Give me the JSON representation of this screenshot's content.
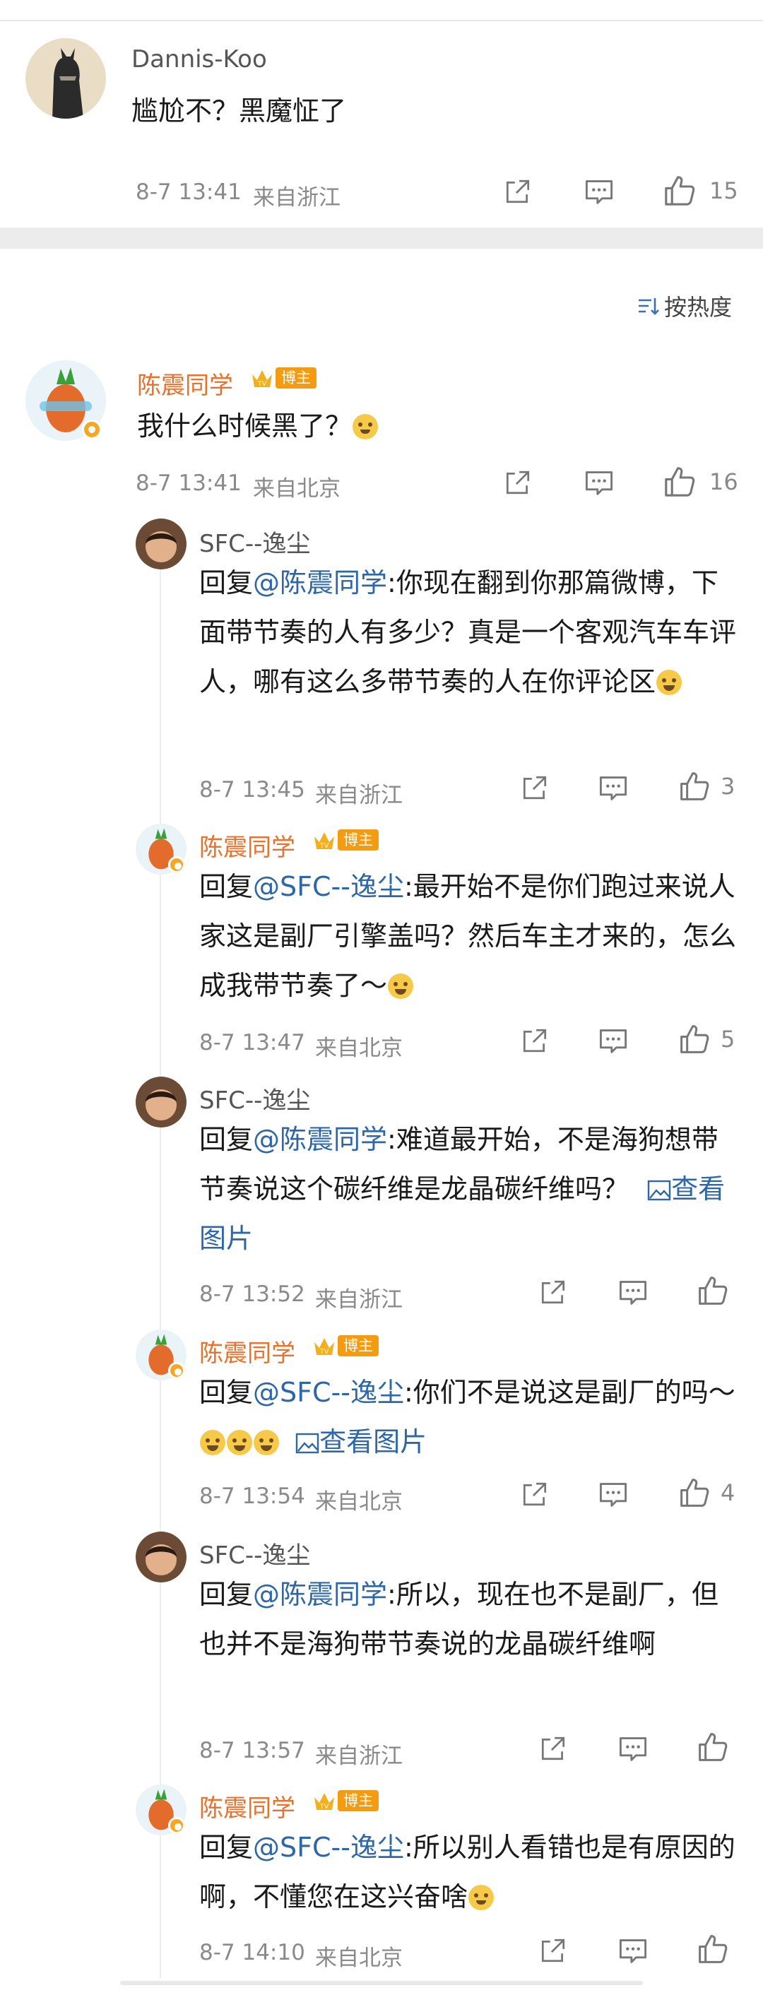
{
  "top_comment": {
    "username": "Dannis-Koo",
    "text": "尴尬不？黑魔怔了",
    "time": "8-7 13:41",
    "source": "来自浙江",
    "likes": "15"
  },
  "sort_label": "按热度",
  "main_comment": {
    "username": "陈震同学",
    "badge": "博主",
    "text": "我什么时候黑了？",
    "time": "8-7 13:41",
    "source": "来自北京",
    "likes": "16"
  },
  "replies": [
    {
      "username": "SFC--逸尘",
      "prefix": "回复",
      "mention": "@陈震同学",
      "text": ":你现在翻到你那篇微博，下面带节奏的人有多少？真是一个客观汽车车评人，哪有这么多带节奏的人在你评论区",
      "time": "8-7 13:45",
      "source": "来自浙江",
      "likes": "3"
    },
    {
      "username": "陈震同学",
      "badge": "博主",
      "prefix": "回复",
      "mention": "@SFC--逸尘",
      "text": ":最开始不是你们跑过来说人家这是副厂引擎盖吗？然后车主才来的，怎么成我带节奏了～",
      "time": "8-7 13:47",
      "source": "来自北京",
      "likes": "5"
    },
    {
      "username": "SFC--逸尘",
      "prefix": "回复",
      "mention": "@陈震同学",
      "text": ":难道最开始，不是海狗想带节奏说这个碳纤维是龙晶碳纤维吗？",
      "link": "查看图片",
      "time": "8-7 13:52",
      "source": "来自浙江",
      "likes": ""
    },
    {
      "username": "陈震同学",
      "badge": "博主",
      "prefix": "回复",
      "mention": "@SFC--逸尘",
      "text": ":你们不是说这是副厂的吗～",
      "link": "查看图片",
      "time": "8-7 13:54",
      "source": "来自北京",
      "likes": "4"
    },
    {
      "username": "SFC--逸尘",
      "prefix": "回复",
      "mention": "@陈震同学",
      "text": ":所以，现在也不是副厂，但也并不是海狗带节奏说的龙晶碳纤维啊",
      "time": "8-7 13:57",
      "source": "来自浙江",
      "likes": ""
    },
    {
      "username": "陈震同学",
      "badge": "博主",
      "prefix": "回复",
      "mention": "@SFC--逸尘",
      "text": ":所以别人看错也是有原因的啊，不懂您在这兴奋啥",
      "time": "8-7 14:10",
      "source": "来自北京",
      "likes": ""
    }
  ],
  "icons": [
    "share-icon",
    "comment-icon",
    "like-icon",
    "sort-icon",
    "image-icon"
  ],
  "colors": {
    "mention": "#2e67a8",
    "blogger_name": "#e8722c",
    "badge": "#f39c12"
  }
}
